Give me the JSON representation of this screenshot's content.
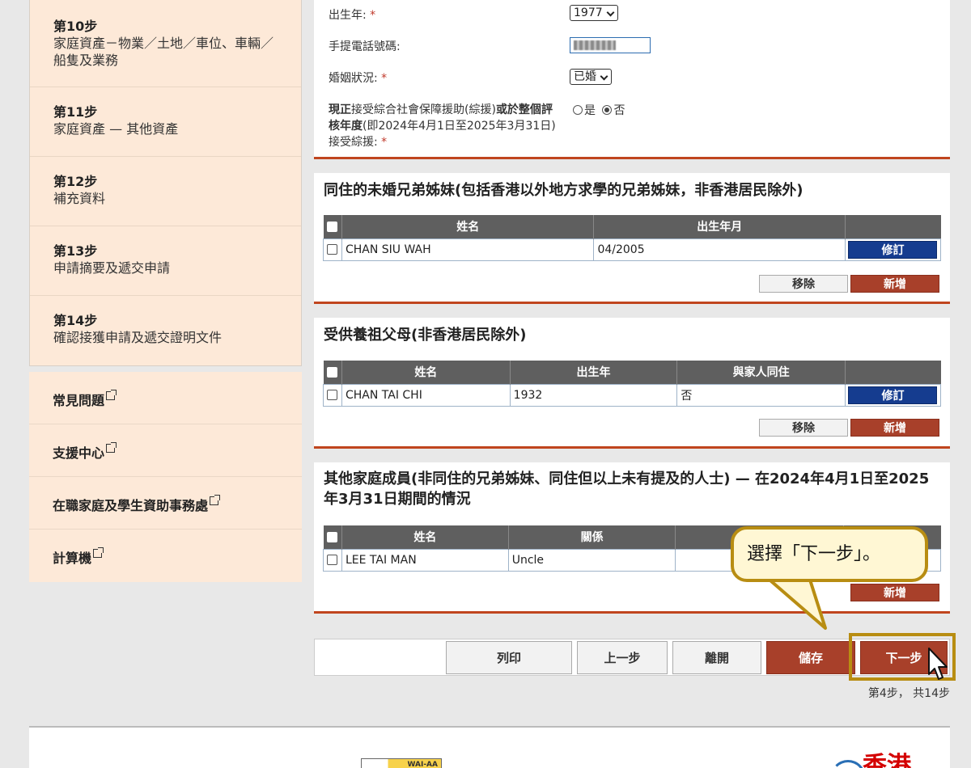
{
  "sidebar": {
    "steps": [
      {
        "title": "第10步",
        "desc": "家庭資產－物業／土地／車位、車輛／船隻及業務"
      },
      {
        "title": "第11步",
        "desc": "家庭資產 — 其他資產"
      },
      {
        "title": "第12步",
        "desc": "補充資料"
      },
      {
        "title": "第13步",
        "desc": "申請摘要及遞交申請"
      },
      {
        "title": "第14步",
        "desc": "確認接獲申請及遞交證明文件"
      }
    ],
    "links": [
      {
        "label": "常見問題"
      },
      {
        "label": "支援中心"
      },
      {
        "label": "在職家庭及學生資助事務處"
      },
      {
        "label": "計算機"
      }
    ]
  },
  "form": {
    "birth_year_label": "出生年:",
    "birth_year_value": "1977",
    "mobile_label": "手提電話號碼:",
    "marital_label": "婚姻狀況:",
    "marital_value": "已婚",
    "cssa_q1": "現正",
    "cssa_q2": "接受綜合社會保障援助(綜援)",
    "cssa_q3": "或於整個",
    "cssa_q4": "評核年度",
    "cssa_q5": "(即2024年4月1日至2025年3月31日) 接受綜援:",
    "required_mark": "*",
    "yes_label": "是",
    "no_label": "否"
  },
  "siblings": {
    "title": "同住的未婚兄弟姊妹(包括香港以外地方求學的兄弟姊妹，非香港居民除外)",
    "headers": [
      "姓名",
      "出生年月"
    ],
    "rows": [
      {
        "name": "CHAN SIU WAH",
        "dob": "04/2005"
      }
    ],
    "edit_label": "修訂",
    "remove_label": "移除",
    "add_label": "新增"
  },
  "grandparents": {
    "title": "受供養祖父母(非香港居民除外)",
    "headers": [
      "姓名",
      "出生年",
      "與家人同住"
    ],
    "rows": [
      {
        "name": "CHAN TAI CHI",
        "year": "1932",
        "live": "否"
      }
    ],
    "edit_label": "修訂",
    "remove_label": "移除",
    "add_label": "新增"
  },
  "others": {
    "title": "其他家庭成員(非同住的兄弟姊妹、同住但以上未有提及的人士) — 在2024年4月1日至2025年3月31日期間的情況",
    "headers": [
      "姓名",
      "關係"
    ],
    "rows": [
      {
        "name": "LEE TAI MAN",
        "relation": "Uncle"
      }
    ],
    "add_label": "新增"
  },
  "nav": {
    "print": "列印",
    "prev": "上一步",
    "leave": "離開",
    "save": "儲存",
    "next": "下一步",
    "step_count": "第4步， 共14步"
  },
  "callout": {
    "text": "選擇「下一步」。"
  },
  "footer": {
    "brand": "香港",
    "wcag_label": "WAI-AA"
  },
  "colors": {
    "accent": "#a8402a",
    "edit": "#153c8f",
    "highlight": "#b88d12",
    "sidebar": "#fde9d8"
  }
}
